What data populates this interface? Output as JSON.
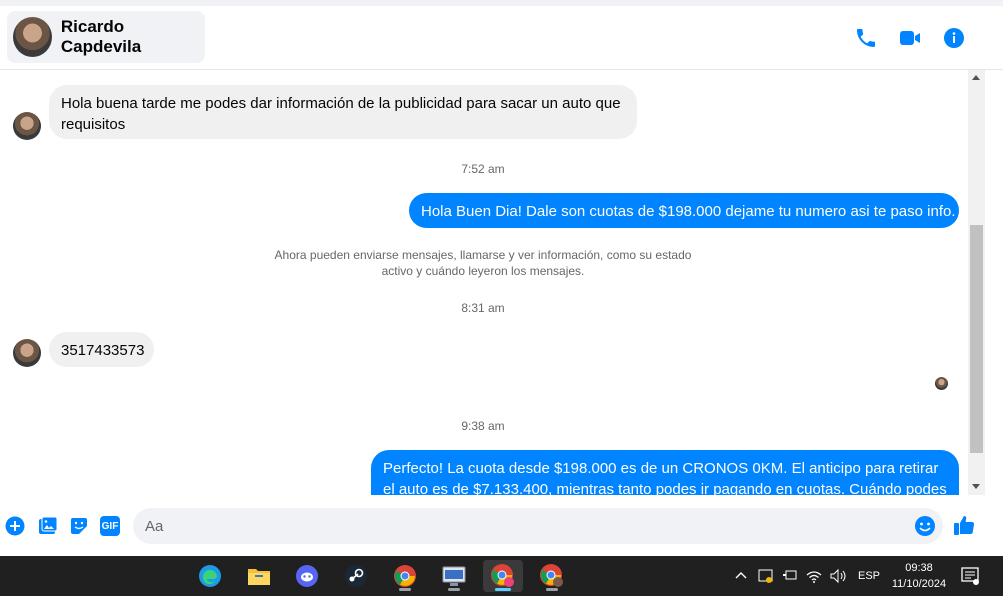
{
  "header": {
    "contact_name": "Ricardo Capdevila",
    "icons": [
      "phone-icon",
      "video-camera-icon",
      "info-icon"
    ]
  },
  "messages": [
    {
      "direction": "incoming",
      "text": "Hola buena tarde me podes dar información de la publicidad para sacar un auto que requisitos"
    },
    {
      "type": "timestamp",
      "text": "7:52 am"
    },
    {
      "direction": "outgoing",
      "text": "Hola Buen Dia! Dale son cuotas de $198.000 dejame tu numero asi te paso info."
    },
    {
      "type": "notice",
      "text": "Ahora pueden enviarse mensajes, llamarse y ver información, como su estado activo y cuándo leyeron los mensajes."
    },
    {
      "type": "timestamp",
      "text": "8:31 am"
    },
    {
      "direction": "incoming",
      "text": "3517433573"
    },
    {
      "type": "timestamp",
      "text": "9:38 am"
    },
    {
      "direction": "outgoing",
      "text": "Perfecto! La cuota desde $198.000 es de un CRONOS 0KM. El anticipo para retirar el auto es de $7.133.400, mientras tanto podes ir pagando en cuotas. Cuándo podes"
    }
  ],
  "composer": {
    "placeholder": "Aa",
    "icons": [
      "plus-icon",
      "image-icon",
      "sticker-icon",
      "gif-icon",
      "emoji-icon",
      "thumbs-up-icon"
    ],
    "gif_label": "GIF"
  },
  "taskbar": {
    "apps": [
      "edge-icon",
      "file-explorer-icon",
      "discord-icon",
      "steam-icon",
      "chrome-icon",
      "browser-icon",
      "chrome-profile-icon",
      "chrome-profile-icon"
    ],
    "language": "ESP",
    "time": "09:38",
    "date": "11/10/2024"
  },
  "colors": {
    "accent": "#0084ff",
    "incoming_bubble": "#f0f0f0",
    "taskbar": "#202020"
  }
}
